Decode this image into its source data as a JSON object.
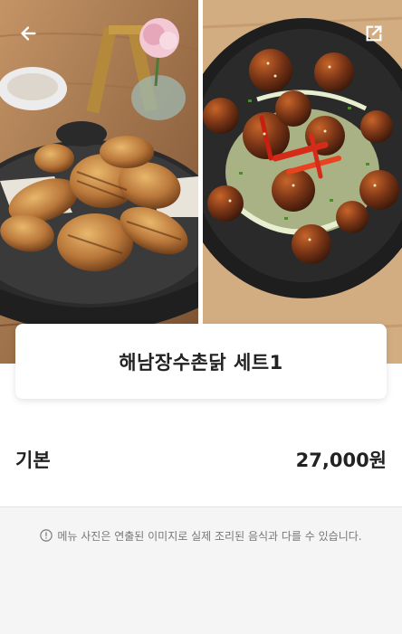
{
  "header": {
    "back_icon": "arrow-left-icon",
    "share_icon": "share-external-icon"
  },
  "product": {
    "title": "해남장수촌닭 세트1"
  },
  "price": {
    "option_label": "기본",
    "amount": "27,000원"
  },
  "notice": {
    "icon": "info-circle-icon",
    "text": "메뉴 사진은 연출된 이미지로 실제 조리된 음식과 다를 수 있습니다."
  },
  "colors": {
    "background": "#f5f5f5",
    "card": "#ffffff",
    "text": "#222222",
    "muted": "#777777"
  }
}
